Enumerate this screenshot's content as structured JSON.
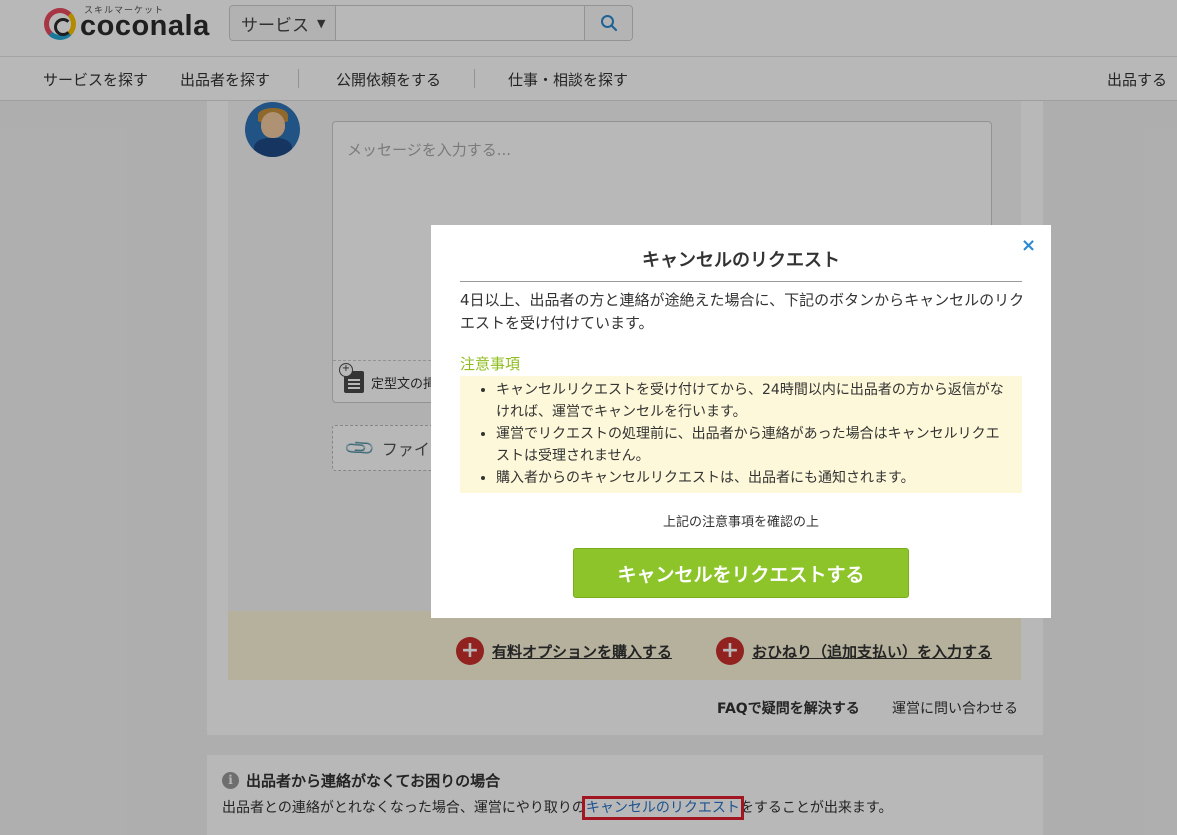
{
  "header": {
    "logo_tagline": "スキルマーケット",
    "logo_text": "coconala",
    "search": {
      "category": "サービス",
      "placeholder": ""
    }
  },
  "nav": {
    "items": [
      "サービスを探す",
      "出品者を探す",
      "公開依頼をする",
      "仕事・相談を探す"
    ],
    "right": "出品する"
  },
  "compose": {
    "placeholder": "メッセージを入力する...",
    "template_label": "定型文の挿",
    "file_label": "ファイル"
  },
  "options": {
    "buy_option": "有料オプションを購入する",
    "tip": "おひねり（追加支払い）を入力する"
  },
  "help": {
    "faq": "FAQで疑問を解決する",
    "contact": "運営に問い合わせる"
  },
  "trouble": {
    "title": "出品者から連絡がなくてお困りの場合",
    "desc_before": "出品者との連絡がとれなくなった場合、運営にやり取りの",
    "desc_link": "キャンセルのリクエスト",
    "desc_after": "をすることが出来ます。"
  },
  "modal": {
    "close": "×",
    "title": "キャンセルのリクエスト",
    "intro": "4日以上、出品者の方と連絡が途絶えた場合に、下記のボタンからキャンセルのリクエストを受け付けています。",
    "notes_heading": "注意事項",
    "notes": [
      "キャンセルリクエストを受け付けてから、24時間以内に出品者の方から返信がなければ、運営でキャンセルを行います。",
      "運営でリクエストの処理前に、出品者から連絡があった場合はキャンセルリクエストは受理されません。",
      "購入者からのキャンセルリクエストは、出品者にも通知されます。"
    ],
    "confirm": "上記の注意事項を確認の上",
    "button": "キャンセルをリクエストする"
  },
  "colors": {
    "accent_green": "#8cc42a",
    "link_blue": "#2a74c9",
    "notes_bg": "#fdf8d9",
    "highlight_red": "#e01f2d"
  }
}
